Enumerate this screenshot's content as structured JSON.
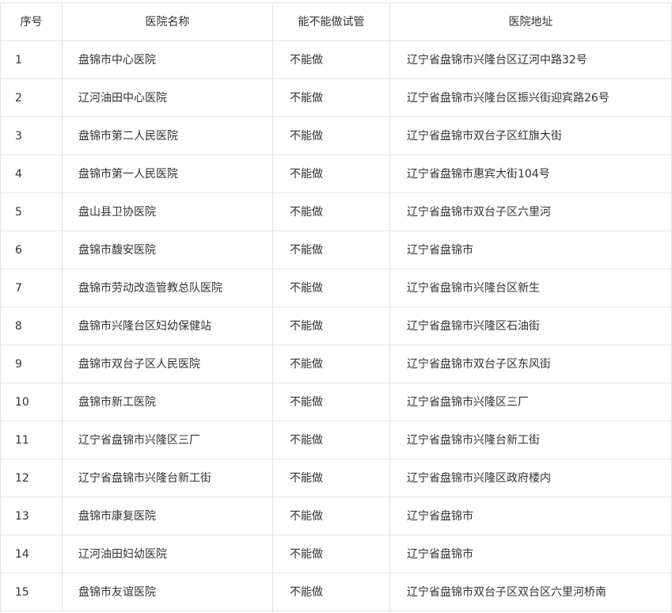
{
  "table": {
    "headers": [
      "序号",
      "医院名称",
      "能不能做试管",
      "医院地址"
    ],
    "rows": [
      [
        "1",
        "盘锦市中心医院",
        "不能做",
        "辽宁省盘锦市兴隆台区辽河中路32号"
      ],
      [
        "2",
        "辽河油田中心医院",
        "不能做",
        "辽宁省盘锦市兴隆台区振兴街迎宾路26号"
      ],
      [
        "3",
        "盘锦市第二人民医院",
        "不能做",
        "辽宁省盘锦市双台子区红旗大街"
      ],
      [
        "4",
        "盘锦市第一人民医院",
        "不能做",
        "辽宁省盘锦市惠宾大街104号"
      ],
      [
        "5",
        "盘山县卫协医院",
        "不能做",
        "辽宁省盘锦市双台子区六里河"
      ],
      [
        "6",
        "盘锦市馥安医院",
        "不能做",
        "辽宁省盘锦市"
      ],
      [
        "7",
        "盘锦市劳动改造管教总队医院",
        "不能做",
        "辽宁省盘锦市兴隆台区新生"
      ],
      [
        "8",
        "盘锦市兴隆台区妇幼保健站",
        "不能做",
        "辽宁省盘锦市兴隆区石油街"
      ],
      [
        "9",
        "盘锦市双台子区人民医院",
        "不能做",
        "辽宁省盘锦市双台子区东风街"
      ],
      [
        "10",
        "盘锦市新工医院",
        "不能做",
        "辽宁省盘锦市兴隆区三厂"
      ],
      [
        "11",
        "辽宁省盘锦市兴隆区三厂",
        "不能做",
        "辽宁省盘锦市兴隆台新工街"
      ],
      [
        "12",
        "辽宁省盘锦市兴隆台新工街",
        "不能做",
        "辽宁省盘锦市兴隆区政府楼内"
      ],
      [
        "13",
        "盘锦市康复医院",
        "不能做",
        "辽宁省盘锦市"
      ],
      [
        "14",
        "辽河油田妇幼医院",
        "不能做",
        "辽宁省盘锦市"
      ],
      [
        "15",
        "盘锦市友谊医院",
        "不能做",
        "辽宁省盘锦市双台子区双台区六里河桥南"
      ]
    ]
  }
}
